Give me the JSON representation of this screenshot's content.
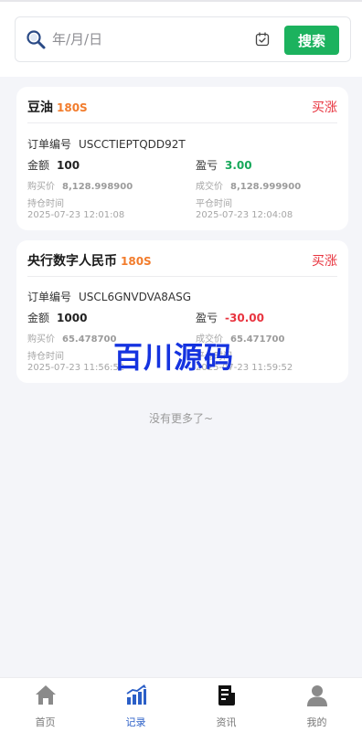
{
  "search": {
    "placeholder": "年/月/日",
    "button_label": "搜索"
  },
  "orders": [
    {
      "name": "豆油",
      "duration": "180S",
      "direction": "买涨",
      "order_no_label": "订单编号",
      "order_no": "USCCTIEPTQDD92T",
      "amount_label": "金额",
      "amount": "100",
      "pnl_label": "盈亏",
      "pnl": "3.00",
      "buy_price_label": "购买价",
      "buy_price": "8,128.998900",
      "deal_price_label": "成交价",
      "deal_price": "8,128.999900",
      "open_time_label": "持仓时间",
      "open_time": "2025-07-23 12:01:08",
      "close_time_label": "平仓时间",
      "close_time": "2025-07-23 12:04:08"
    },
    {
      "name": "央行数字人民币",
      "duration": "180S",
      "direction": "买涨",
      "order_no_label": "订单编号",
      "order_no": "USCL6GNVDVA8ASG",
      "amount_label": "金额",
      "amount": "1000",
      "pnl_label": "盈亏",
      "pnl": "-30.00",
      "buy_price_label": "购买价",
      "buy_price": "65.478700",
      "deal_price_label": "成交价",
      "deal_price": "65.471700",
      "open_time_label": "持仓时间",
      "open_time": "2025-07-23 11:56:52",
      "close_time_label": "平仓时间",
      "close_time": "2025-07-23 11:59:52"
    }
  ],
  "list_end_text": "没有更多了~",
  "watermark": "百川源码",
  "tabbar": {
    "items": [
      {
        "label": "首页",
        "icon": "home-icon",
        "active": false
      },
      {
        "label": "记录",
        "icon": "chart-icon",
        "active": true
      },
      {
        "label": "资讯",
        "icon": "news-icon",
        "active": false
      },
      {
        "label": "我的",
        "icon": "user-icon",
        "active": false
      }
    ]
  },
  "colors": {
    "accent_green": "#1cb25e",
    "profit_green": "#17a85a",
    "loss_red": "#e8343f",
    "duration_orange": "#f27c2c",
    "tab_active_blue": "#2b5fc7"
  }
}
